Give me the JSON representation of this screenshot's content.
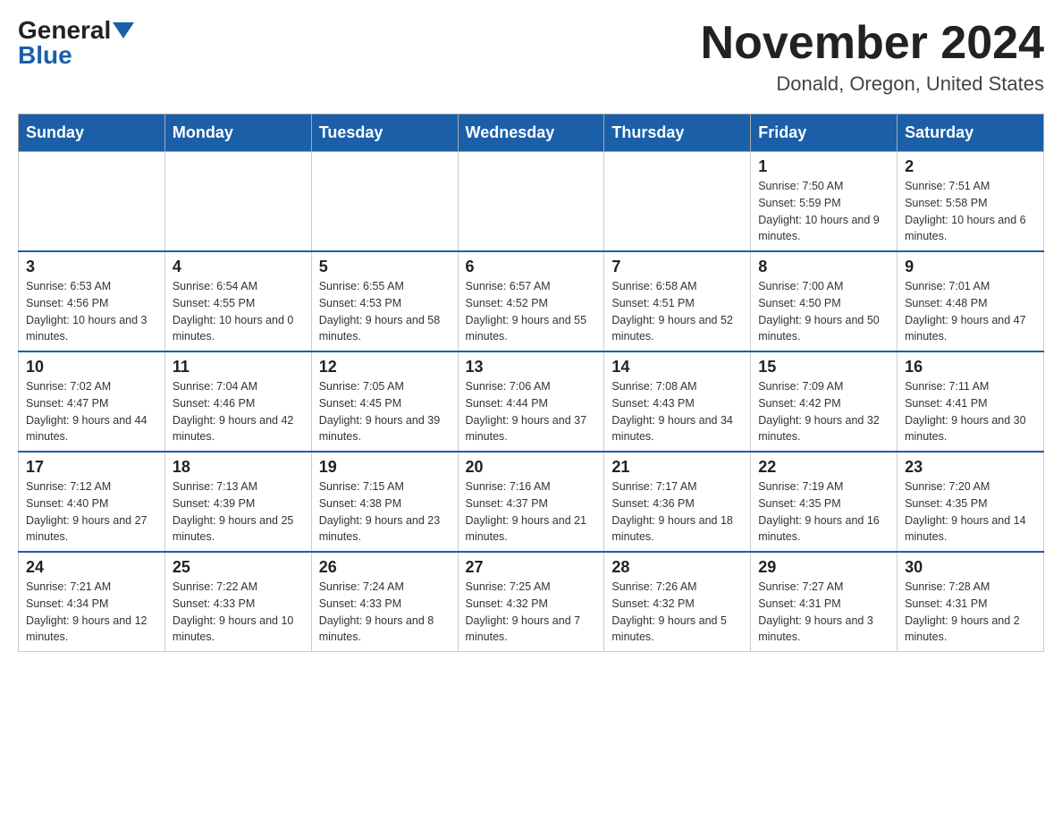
{
  "header": {
    "logo_general": "General",
    "logo_blue": "Blue",
    "month_title": "November 2024",
    "location": "Donald, Oregon, United States"
  },
  "days_of_week": [
    "Sunday",
    "Monday",
    "Tuesday",
    "Wednesday",
    "Thursday",
    "Friday",
    "Saturday"
  ],
  "weeks": [
    [
      {
        "day": "",
        "sunrise": "",
        "sunset": "",
        "daylight": ""
      },
      {
        "day": "",
        "sunrise": "",
        "sunset": "",
        "daylight": ""
      },
      {
        "day": "",
        "sunrise": "",
        "sunset": "",
        "daylight": ""
      },
      {
        "day": "",
        "sunrise": "",
        "sunset": "",
        "daylight": ""
      },
      {
        "day": "",
        "sunrise": "",
        "sunset": "",
        "daylight": ""
      },
      {
        "day": "1",
        "sunrise": "Sunrise: 7:50 AM",
        "sunset": "Sunset: 5:59 PM",
        "daylight": "Daylight: 10 hours and 9 minutes."
      },
      {
        "day": "2",
        "sunrise": "Sunrise: 7:51 AM",
        "sunset": "Sunset: 5:58 PM",
        "daylight": "Daylight: 10 hours and 6 minutes."
      }
    ],
    [
      {
        "day": "3",
        "sunrise": "Sunrise: 6:53 AM",
        "sunset": "Sunset: 4:56 PM",
        "daylight": "Daylight: 10 hours and 3 minutes."
      },
      {
        "day": "4",
        "sunrise": "Sunrise: 6:54 AM",
        "sunset": "Sunset: 4:55 PM",
        "daylight": "Daylight: 10 hours and 0 minutes."
      },
      {
        "day": "5",
        "sunrise": "Sunrise: 6:55 AM",
        "sunset": "Sunset: 4:53 PM",
        "daylight": "Daylight: 9 hours and 58 minutes."
      },
      {
        "day": "6",
        "sunrise": "Sunrise: 6:57 AM",
        "sunset": "Sunset: 4:52 PM",
        "daylight": "Daylight: 9 hours and 55 minutes."
      },
      {
        "day": "7",
        "sunrise": "Sunrise: 6:58 AM",
        "sunset": "Sunset: 4:51 PM",
        "daylight": "Daylight: 9 hours and 52 minutes."
      },
      {
        "day": "8",
        "sunrise": "Sunrise: 7:00 AM",
        "sunset": "Sunset: 4:50 PM",
        "daylight": "Daylight: 9 hours and 50 minutes."
      },
      {
        "day": "9",
        "sunrise": "Sunrise: 7:01 AM",
        "sunset": "Sunset: 4:48 PM",
        "daylight": "Daylight: 9 hours and 47 minutes."
      }
    ],
    [
      {
        "day": "10",
        "sunrise": "Sunrise: 7:02 AM",
        "sunset": "Sunset: 4:47 PM",
        "daylight": "Daylight: 9 hours and 44 minutes."
      },
      {
        "day": "11",
        "sunrise": "Sunrise: 7:04 AM",
        "sunset": "Sunset: 4:46 PM",
        "daylight": "Daylight: 9 hours and 42 minutes."
      },
      {
        "day": "12",
        "sunrise": "Sunrise: 7:05 AM",
        "sunset": "Sunset: 4:45 PM",
        "daylight": "Daylight: 9 hours and 39 minutes."
      },
      {
        "day": "13",
        "sunrise": "Sunrise: 7:06 AM",
        "sunset": "Sunset: 4:44 PM",
        "daylight": "Daylight: 9 hours and 37 minutes."
      },
      {
        "day": "14",
        "sunrise": "Sunrise: 7:08 AM",
        "sunset": "Sunset: 4:43 PM",
        "daylight": "Daylight: 9 hours and 34 minutes."
      },
      {
        "day": "15",
        "sunrise": "Sunrise: 7:09 AM",
        "sunset": "Sunset: 4:42 PM",
        "daylight": "Daylight: 9 hours and 32 minutes."
      },
      {
        "day": "16",
        "sunrise": "Sunrise: 7:11 AM",
        "sunset": "Sunset: 4:41 PM",
        "daylight": "Daylight: 9 hours and 30 minutes."
      }
    ],
    [
      {
        "day": "17",
        "sunrise": "Sunrise: 7:12 AM",
        "sunset": "Sunset: 4:40 PM",
        "daylight": "Daylight: 9 hours and 27 minutes."
      },
      {
        "day": "18",
        "sunrise": "Sunrise: 7:13 AM",
        "sunset": "Sunset: 4:39 PM",
        "daylight": "Daylight: 9 hours and 25 minutes."
      },
      {
        "day": "19",
        "sunrise": "Sunrise: 7:15 AM",
        "sunset": "Sunset: 4:38 PM",
        "daylight": "Daylight: 9 hours and 23 minutes."
      },
      {
        "day": "20",
        "sunrise": "Sunrise: 7:16 AM",
        "sunset": "Sunset: 4:37 PM",
        "daylight": "Daylight: 9 hours and 21 minutes."
      },
      {
        "day": "21",
        "sunrise": "Sunrise: 7:17 AM",
        "sunset": "Sunset: 4:36 PM",
        "daylight": "Daylight: 9 hours and 18 minutes."
      },
      {
        "day": "22",
        "sunrise": "Sunrise: 7:19 AM",
        "sunset": "Sunset: 4:35 PM",
        "daylight": "Daylight: 9 hours and 16 minutes."
      },
      {
        "day": "23",
        "sunrise": "Sunrise: 7:20 AM",
        "sunset": "Sunset: 4:35 PM",
        "daylight": "Daylight: 9 hours and 14 minutes."
      }
    ],
    [
      {
        "day": "24",
        "sunrise": "Sunrise: 7:21 AM",
        "sunset": "Sunset: 4:34 PM",
        "daylight": "Daylight: 9 hours and 12 minutes."
      },
      {
        "day": "25",
        "sunrise": "Sunrise: 7:22 AM",
        "sunset": "Sunset: 4:33 PM",
        "daylight": "Daylight: 9 hours and 10 minutes."
      },
      {
        "day": "26",
        "sunrise": "Sunrise: 7:24 AM",
        "sunset": "Sunset: 4:33 PM",
        "daylight": "Daylight: 9 hours and 8 minutes."
      },
      {
        "day": "27",
        "sunrise": "Sunrise: 7:25 AM",
        "sunset": "Sunset: 4:32 PM",
        "daylight": "Daylight: 9 hours and 7 minutes."
      },
      {
        "day": "28",
        "sunrise": "Sunrise: 7:26 AM",
        "sunset": "Sunset: 4:32 PM",
        "daylight": "Daylight: 9 hours and 5 minutes."
      },
      {
        "day": "29",
        "sunrise": "Sunrise: 7:27 AM",
        "sunset": "Sunset: 4:31 PM",
        "daylight": "Daylight: 9 hours and 3 minutes."
      },
      {
        "day": "30",
        "sunrise": "Sunrise: 7:28 AM",
        "sunset": "Sunset: 4:31 PM",
        "daylight": "Daylight: 9 hours and 2 minutes."
      }
    ]
  ]
}
